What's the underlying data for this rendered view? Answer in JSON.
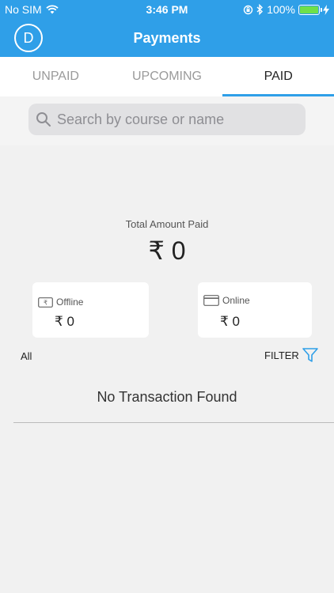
{
  "status_bar": {
    "carrier": "No SIM",
    "time": "3:46 PM",
    "battery": "100%"
  },
  "header": {
    "avatar_initial": "D",
    "title": "Payments"
  },
  "tabs": [
    {
      "label": "UNPAID",
      "active": false
    },
    {
      "label": "UPCOMING",
      "active": false
    },
    {
      "label": "PAID",
      "active": true
    }
  ],
  "search": {
    "placeholder": "Search by course or name"
  },
  "summary": {
    "total_label": "Total Amount Paid",
    "total_amount": "₹ 0"
  },
  "cards": {
    "offline": {
      "label": "Offline",
      "amount": "₹ 0"
    },
    "online": {
      "label": "Online",
      "amount": "₹ 0"
    }
  },
  "filter_bar": {
    "scope": "All",
    "filter_label": "FILTER"
  },
  "empty_state": {
    "message": "No Transaction Found"
  },
  "colors": {
    "accent": "#2f9fe8",
    "background": "#f1f1f1",
    "battery": "#6fe04a"
  }
}
